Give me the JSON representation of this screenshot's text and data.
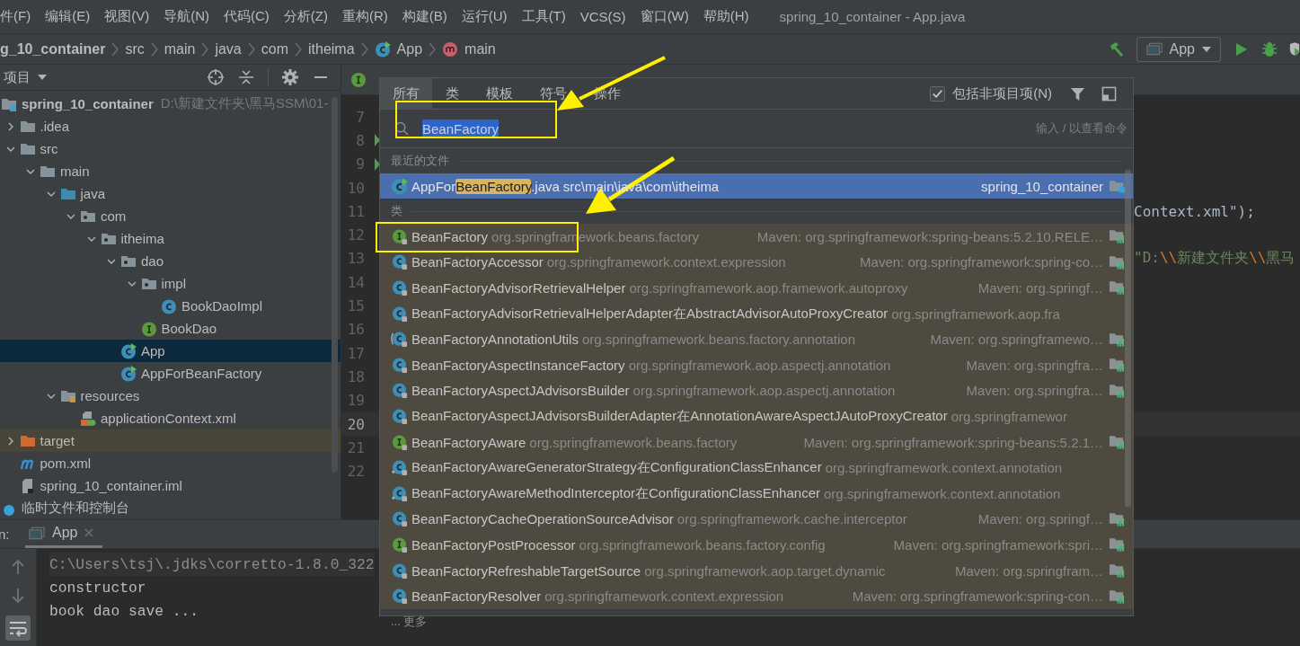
{
  "menu": [
    {
      "label": "件(F)"
    },
    {
      "label": "编辑(E)"
    },
    {
      "label": "视图(V)"
    },
    {
      "label": "导航(N)"
    },
    {
      "label": "代码(C)"
    },
    {
      "label": "分析(Z)"
    },
    {
      "label": "重构(R)"
    },
    {
      "label": "构建(B)"
    },
    {
      "label": "运行(U)"
    },
    {
      "label": "工具(T)"
    },
    {
      "label": "VCS(S)"
    },
    {
      "label": "窗口(W)"
    },
    {
      "label": "帮助(H)"
    }
  ],
  "window_title": "spring_10_container - App.java",
  "breadcrumb": [
    {
      "label": "g_10_container",
      "kind": "module"
    },
    {
      "label": "src",
      "kind": "dir"
    },
    {
      "label": "main",
      "kind": "dir"
    },
    {
      "label": "java",
      "kind": "dir"
    },
    {
      "label": "com",
      "kind": "dir"
    },
    {
      "label": "itheima",
      "kind": "dir"
    },
    {
      "label": "App",
      "kind": "class"
    },
    {
      "label": "main",
      "kind": "method"
    }
  ],
  "run_config": {
    "label": "App"
  },
  "project_panel": {
    "title": "项目",
    "tree": [
      {
        "label": "spring_10_container",
        "kind": "module",
        "note": "D:\\新建文件夹\\黑马SSM\\01-",
        "selected": false,
        "children": [
          {
            "label": ".idea",
            "kind": "folder",
            "expanded": false,
            "selected": false
          },
          {
            "label": "src",
            "kind": "folder",
            "expanded": true,
            "selected": false,
            "children": [
              {
                "label": "main",
                "kind": "folder",
                "expanded": true,
                "selected": false,
                "children": [
                  {
                    "label": "java",
                    "kind": "source-folder",
                    "expanded": true,
                    "selected": false,
                    "children": [
                      {
                        "label": "com",
                        "kind": "package",
                        "expanded": true,
                        "selected": false,
                        "children": [
                          {
                            "label": "itheima",
                            "kind": "package",
                            "expanded": true,
                            "selected": false,
                            "children": [
                              {
                                "label": "dao",
                                "kind": "package",
                                "expanded": true,
                                "selected": false,
                                "children": [
                                  {
                                    "label": "impl",
                                    "kind": "package",
                                    "expanded": true,
                                    "selected": false,
                                    "children": [
                                      {
                                        "label": "BookDaoImpl",
                                        "kind": "class",
                                        "selected": false
                                      }
                                    ]
                                  },
                                  {
                                    "label": "BookDao",
                                    "kind": "interface",
                                    "selected": false
                                  }
                                ]
                              },
                              {
                                "label": "App",
                                "kind": "runnable",
                                "selected": true
                              },
                              {
                                "label": "AppForBeanFactory",
                                "kind": "runnable",
                                "selected": false
                              }
                            ]
                          }
                        ]
                      }
                    ]
                  },
                  {
                    "label": "resources",
                    "kind": "resources",
                    "expanded": true,
                    "selected": false,
                    "children": [
                      {
                        "label": "applicationContext.xml",
                        "kind": "xml",
                        "selected": false
                      }
                    ]
                  }
                ]
              }
            ]
          },
          {
            "label": "target",
            "kind": "excluded",
            "expanded": false,
            "selected": false
          },
          {
            "label": "pom.xml",
            "kind": "maven",
            "selected": false
          },
          {
            "label": "spring_10_container.iml",
            "kind": "iml",
            "selected": false
          }
        ]
      },
      {
        "label": "临时文件和控制台",
        "kind": "scratch",
        "selected": false
      }
    ]
  },
  "editor": {
    "tabs": [
      {
        "kind": "interface",
        "selected": false
      }
    ],
    "lines": [
      {
        "number": "7",
        "run_marker": false,
        "current": false
      },
      {
        "number": "8",
        "run_marker": true,
        "current": false
      },
      {
        "number": "9",
        "run_marker": true,
        "current": false
      },
      {
        "number": "10",
        "run_marker": false,
        "current": false
      },
      {
        "number": "11",
        "run_marker": false,
        "current": false,
        "segments": [
          {
            "text": "Context.xml\");",
            "kind": "plain"
          }
        ]
      },
      {
        "number": "12",
        "run_marker": false,
        "current": false
      },
      {
        "number": "13",
        "run_marker": false,
        "current": false,
        "segments": [
          {
            "text": "\"D:",
            "kind": "string"
          },
          {
            "text": "\\\\",
            "kind": "escape"
          },
          {
            "text": "新建文件夹",
            "kind": "string"
          },
          {
            "text": "\\\\",
            "kind": "escape"
          },
          {
            "text": "黑马",
            "kind": "string"
          }
        ]
      },
      {
        "number": "14",
        "run_marker": false,
        "current": false
      },
      {
        "number": "15",
        "run_marker": false,
        "current": false
      },
      {
        "number": "16",
        "run_marker": false,
        "current": false
      },
      {
        "number": "17",
        "run_marker": false,
        "current": false
      },
      {
        "number": "18",
        "run_marker": false,
        "current": false
      },
      {
        "number": "19",
        "run_marker": false,
        "current": false
      },
      {
        "number": "20",
        "run_marker": false,
        "current": true
      },
      {
        "number": "21",
        "run_marker": false,
        "current": false
      },
      {
        "number": "22",
        "run_marker": false,
        "current": false
      }
    ]
  },
  "search_popup": {
    "tabs": [
      {
        "label": "所有",
        "selected": true
      },
      {
        "label": "类",
        "selected": false
      },
      {
        "label": "模板",
        "selected": false
      },
      {
        "label": "符号",
        "selected": false
      },
      {
        "label": "操作",
        "selected": false
      }
    ],
    "include_non_project": {
      "label": "包括非项目项(N)",
      "checked": true
    },
    "search": {
      "value": "BeanFactory",
      "hint": "输入 / 以查看命令"
    },
    "recent_files": {
      "title": "最近的文件",
      "items": [
        {
          "prefix": "AppFor",
          "match": "BeanFactory",
          "suffix": ".java",
          "path": "src\\main\\java\\com\\itheima",
          "module": "spring_10_container",
          "selected": true
        }
      ]
    },
    "classes": {
      "title": "类",
      "items": [
        {
          "kind": "interface",
          "name": "BeanFactory",
          "package": "org.springframework.beans.factory",
          "library": "Maven: org.springframework:spring-beans:5.2.10.RELE…",
          "selected": false
        },
        {
          "kind": "class",
          "name": "BeanFactoryAccessor",
          "package": "org.springframework.context.expression",
          "library": "Maven: org.springframework:spring-co…",
          "selected": false
        },
        {
          "kind": "class",
          "name": "BeanFactoryAdvisorRetrievalHelper",
          "package": "org.springframework.aop.framework.autoproxy",
          "library": "Maven: org.springf…",
          "selected": false
        },
        {
          "kind": "class",
          "name": "BeanFactoryAdvisorRetrievalHelperAdapter在AbstractAdvisorAutoProxyCreator",
          "package": "org.springframework.aop.fra",
          "selected": false
        },
        {
          "kind": "abstract",
          "name": "BeanFactoryAnnotationUtils",
          "package": "org.springframework.beans.factory.annotation",
          "library": "Maven: org.springframewo…",
          "selected": false
        },
        {
          "kind": "class",
          "name": "BeanFactoryAspectInstanceFactory",
          "package": "org.springframework.aop.aspectj.annotation",
          "library": "Maven: org.springfra…",
          "selected": false
        },
        {
          "kind": "class",
          "name": "BeanFactoryAspectJAdvisorsBuilder",
          "package": "org.springframework.aop.aspectj.annotation",
          "library": "Maven: org.springfra…",
          "selected": false
        },
        {
          "kind": "class",
          "name": "BeanFactoryAspectJAdvisorsBuilderAdapter在AnnotationAwareAspectJAutoProxyCreator",
          "package": "org.springframewor",
          "selected": false
        },
        {
          "kind": "interface",
          "name": "BeanFactoryAware",
          "package": "org.springframework.beans.factory",
          "library": "Maven: org.springframework:spring-beans:5.2.1…",
          "selected": false
        },
        {
          "kind": "nested",
          "name": "BeanFactoryAwareGeneratorStrategy在ConfigurationClassEnhancer",
          "package": "org.springframework.context.annotation",
          "selected": false
        },
        {
          "kind": "nested",
          "name": "BeanFactoryAwareMethodInterceptor在ConfigurationClassEnhancer",
          "package": "org.springframework.context.annotation",
          "selected": false
        },
        {
          "kind": "class",
          "name": "BeanFactoryCacheOperationSourceAdvisor",
          "package": "org.springframework.cache.interceptor",
          "library": "Maven: org.springf…",
          "selected": false
        },
        {
          "kind": "interface",
          "name": "BeanFactoryPostProcessor",
          "package": "org.springframework.beans.factory.config",
          "library": "Maven: org.springframework:spri…",
          "selected": false
        },
        {
          "kind": "class",
          "name": "BeanFactoryRefreshableTargetSource",
          "package": "org.springframework.aop.target.dynamic",
          "library": "Maven: org.springfram…",
          "selected": false
        },
        {
          "kind": "class",
          "name": "BeanFactoryResolver",
          "package": "org.springframework.context.expression",
          "library": "Maven: org.springframework:spring-con…",
          "selected": false
        }
      ]
    },
    "more": "... 更多"
  },
  "run_panel": {
    "label": "n:",
    "tabs": [
      {
        "label": "App",
        "selected": true
      }
    ],
    "soft_wrap": true,
    "console": [
      "C:\\Users\\tsj\\.jdks\\corretto-1.8.0_322",
      "constructor",
      "book dao save ..."
    ]
  }
}
